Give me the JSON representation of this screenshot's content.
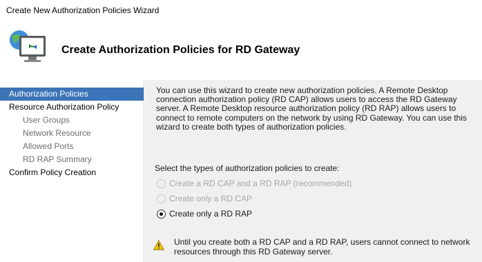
{
  "window": {
    "title": "Create New Authorization Policies Wizard"
  },
  "header": {
    "title": "Create Authorization Policies for RD Gateway",
    "icon": "network-computer-icon"
  },
  "nav": {
    "items": [
      {
        "label": "Authorization Policies",
        "level": 0,
        "selected": true
      },
      {
        "label": "Resource Authorization Policy",
        "level": 0,
        "selected": false
      },
      {
        "label": "User Groups",
        "level": 1,
        "selected": false
      },
      {
        "label": "Network Resource",
        "level": 1,
        "selected": false
      },
      {
        "label": "Allowed Ports",
        "level": 1,
        "selected": false
      },
      {
        "label": "RD RAP Summary",
        "level": 1,
        "selected": false
      },
      {
        "label": "Confirm Policy Creation",
        "level": 0,
        "selected": false
      }
    ]
  },
  "content": {
    "intro": "You can use this wizard to create new authorization policies. A Remote Desktop connection authorization policy (RD CAP) allows users to access the RD Gateway server. A Remote Desktop resource authorization policy (RD RAP) allows users to connect to remote computers on the network by using RD Gateway. You can use this wizard to create both types of authorization policies.",
    "select_label": "Select the types of authorization policies to create:",
    "options": [
      {
        "label": "Create a RD CAP and a RD RAP (recommended)",
        "enabled": false,
        "checked": false
      },
      {
        "label": "Create only a RD CAP",
        "enabled": false,
        "checked": false
      },
      {
        "label": "Create only a RD RAP",
        "enabled": true,
        "checked": true
      }
    ],
    "warning": {
      "icon": "warning-icon",
      "text": "Until you create both a RD CAP and a RD RAP, users cannot connect to network resources through this RD Gateway server."
    }
  },
  "colors": {
    "nav_selected": "#3c74b8",
    "content_bg": "#f0f0f0",
    "disabled_text": "#a6a6a6"
  }
}
